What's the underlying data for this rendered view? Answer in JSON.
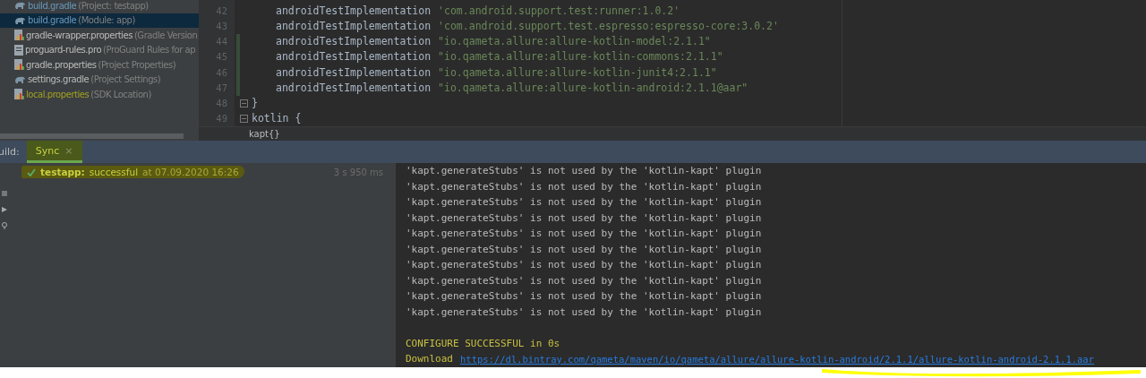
{
  "project_tree": {
    "items": [
      {
        "kind": "gradle",
        "name": "build.gradle",
        "detail": "(Project: testapp)",
        "selected": false,
        "color": "#6897bb"
      },
      {
        "kind": "gradle",
        "name": "build.gradle",
        "detail": "(Module: app)",
        "selected": true,
        "color": "#6897bb"
      },
      {
        "kind": "properties",
        "name": "gradle-wrapper.properties",
        "detail": "(Gradle Version",
        "selected": false,
        "color": "#bbbbbb"
      },
      {
        "kind": "file",
        "name": "proguard-rules.pro",
        "detail": "(ProGuard Rules for ap",
        "selected": false,
        "color": "#bbbbbb"
      },
      {
        "kind": "properties",
        "name": "gradle.properties",
        "detail": "(Project Properties)",
        "selected": false,
        "color": "#bbbbbb"
      },
      {
        "kind": "gradle",
        "name": "settings.gradle",
        "detail": "(Project Settings)",
        "selected": false,
        "color": "#bbbbbb"
      },
      {
        "kind": "properties",
        "name": "local.properties",
        "detail": "(SDK Location)",
        "selected": false,
        "color": "#a0a020"
      }
    ]
  },
  "editor": {
    "lines": [
      {
        "number": "42",
        "code": "androidTestImplementation",
        "string": "'com.android.support.test:runner:1.0.2'",
        "changed": false
      },
      {
        "number": "43",
        "code": "androidTestImplementation",
        "string": "'com.android.support.test.espresso:espresso-core:3.0.2'",
        "changed": false
      },
      {
        "number": "44",
        "code": "androidTestImplementation",
        "string": "\"io.qameta.allure:allure-kotlin-model:2.1.1\"",
        "changed": true
      },
      {
        "number": "45",
        "code": "androidTestImplementation",
        "string": "\"io.qameta.allure:allure-kotlin-commons:2.1.1\"",
        "changed": true
      },
      {
        "number": "46",
        "code": "androidTestImplementation",
        "string": "\"io.qameta.allure:allure-kotlin-junit4:2.1.1\"",
        "changed": true
      },
      {
        "number": "47",
        "code": "androidTestImplementation",
        "string": "\"io.qameta.allure:allure-kotlin-android:2.1.1@aar\"",
        "changed": true
      },
      {
        "number": "48",
        "code": "}",
        "fold": true,
        "changed": false
      },
      {
        "number": "49",
        "code": "kotlin {",
        "fold": true,
        "changed": false
      }
    ],
    "breadcrumb": "kapt{}"
  },
  "build_panel": {
    "label": "uild:",
    "tabs": [
      {
        "label": "Sync",
        "selected": true,
        "close": "×"
      }
    ],
    "tree": {
      "project": "testapp:",
      "status": "successful",
      "time": "at 07.09.2020 16:26",
      "duration": "3 s 950 ms"
    },
    "console": {
      "lines": [
        "'kapt.generateStubs' is not used by the 'kotlin-kapt' plugin",
        "'kapt.generateStubs' is not used by the 'kotlin-kapt' plugin",
        "'kapt.generateStubs' is not used by the 'kotlin-kapt' plugin",
        "'kapt.generateStubs' is not used by the 'kotlin-kapt' plugin",
        "'kapt.generateStubs' is not used by the 'kotlin-kapt' plugin",
        "'kapt.generateStubs' is not used by the 'kotlin-kapt' plugin",
        "'kapt.generateStubs' is not used by the 'kotlin-kapt' plugin",
        "'kapt.generateStubs' is not used by the 'kotlin-kapt' plugin",
        "'kapt.generateStubs' is not used by the 'kotlin-kapt' plugin",
        "'kapt.generateStubs' is not used by the 'kotlin-kapt' plugin"
      ],
      "result": "CONFIGURE SUCCESSFUL in 0s",
      "download_label": "Download",
      "download_link": "https://dl.bintray.com/qameta/maven/io/qameta/allure/allure-kotlin-android/2.1.1/allure-kotlin-android-2.1.1.aar"
    }
  }
}
